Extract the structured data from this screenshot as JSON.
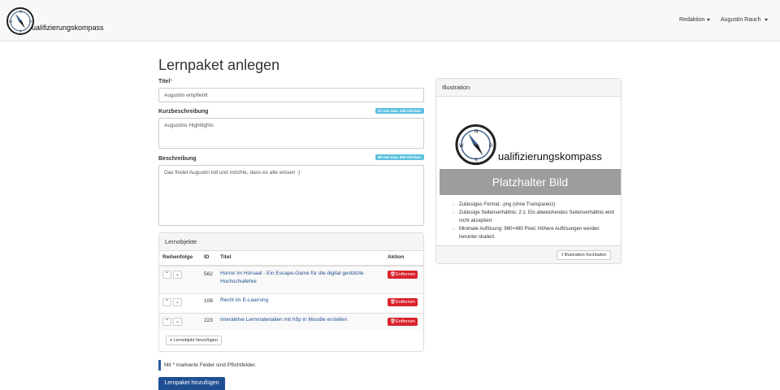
{
  "nav": {
    "brand": "ualifizierungskompass",
    "menu_redaktion": "Redaktion",
    "menu_user": "Augustin Rauch"
  },
  "page_title": "Lernpaket anlegen",
  "form": {
    "title_label": "Titel",
    "title_required_mark": "*",
    "title_value": "Augustin empfiehlt",
    "short_label": "Kurzbeschreibung",
    "short_badge": "21 von max. 200 Zeichen.",
    "short_value": "Augustins Hightlights",
    "desc_label": "Beschreibung",
    "desc_badge": "58 von max. 800 Zeichen.",
    "desc_value": "Das findet Augustin toll und möchte, dass es alle wissen :)"
  },
  "lernobjekte": {
    "heading": "Lernobjekte",
    "columns": [
      "Reihenfolge",
      "ID",
      "Titel",
      "Aktion"
    ],
    "rows": [
      {
        "id": "562",
        "title": "Horror im Hörsaal - Ein Escape-Game für die digital gestützte Hochschullehre",
        "action": "Entfernen"
      },
      {
        "id": "108",
        "title": "Recht im E-Learning",
        "action": "Entfernen"
      },
      {
        "id": "223",
        "title": "Interaktive Lernmaterialien mit h5p in Moodle erstellen",
        "action": "Entfernen"
      }
    ],
    "add_label": "Lernobjekt hinzufügen"
  },
  "illustration": {
    "heading": "Illustration",
    "logo_text": "ualifizierungskompass",
    "placeholder": "Platzhalter Bild",
    "rules": [
      "Zulässiges Format: .png (ohne Transparenz)",
      "Zulässige Seitenverhältnis: 2:1. Ein abweichendes Seitenverhältnis wird nicht akzeptiert",
      "Minimale Auflösung: 960×480 Pixel; Höhere Auflösungen werden herunter skaliert."
    ],
    "upload_label": "Illustration hochladen"
  },
  "footer": {
    "note": "Mit * markierte Felder sind Pflichtfelder.",
    "submit_label": "Lernpaket hinzufügen"
  },
  "colors": {
    "primary": "#1e4f92",
    "danger": "#d9232d",
    "info": "#5bc0de",
    "link": "#1f4f8f"
  }
}
